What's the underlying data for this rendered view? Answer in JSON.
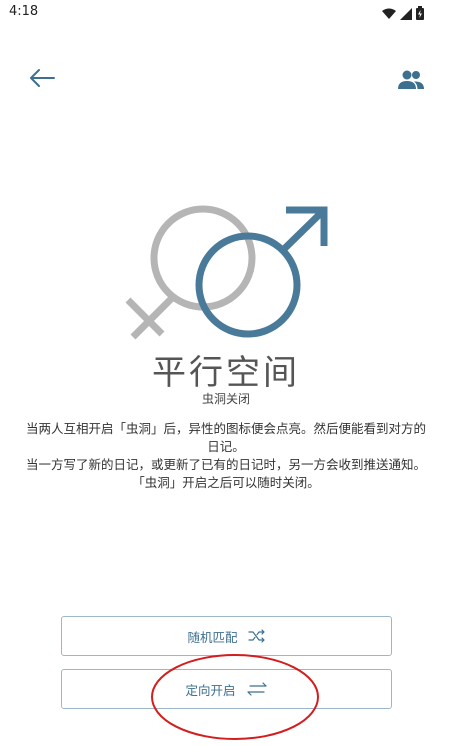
{
  "status_bar": {
    "time": "4:18",
    "icons": [
      "wifi-icon",
      "signal-icon",
      "battery-charging-icon"
    ]
  },
  "header": {
    "back_icon": "arrow-left-icon",
    "people_icon": "people-icon"
  },
  "illustration": {
    "icon": "female-male-symbols-icon",
    "colors": {
      "female": "#b5b5b5",
      "male": "#4a7a99"
    }
  },
  "main": {
    "title": "平行空间",
    "status": "虫洞关闭",
    "description": [
      "当两人互相开启「虫洞」后，异性的图标便会点亮。然后便能看到对方的日记。",
      "当一方写了新的日记，或更新了已有的日记时，另一方会收到推送通知。",
      "「虫洞」开启之后可以随时关闭。"
    ]
  },
  "actions": {
    "random_match": "随机匹配",
    "directed_open": "定向开启"
  },
  "colors": {
    "accent": "#3d6f8f",
    "button_border": "#9bb7c8",
    "annotation": "#d21e1e"
  }
}
